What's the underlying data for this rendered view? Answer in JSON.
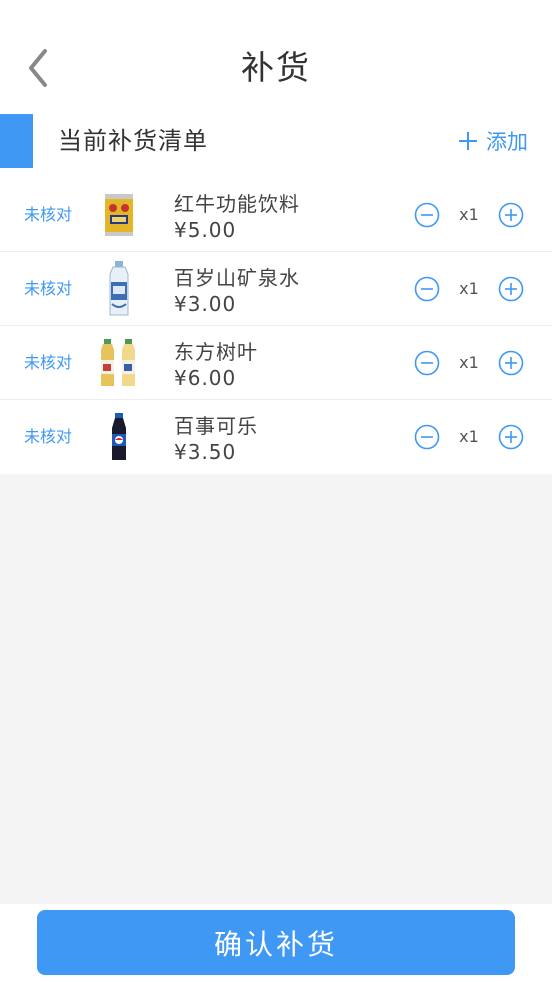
{
  "header": {
    "title": "补货",
    "back_icon": "chevron-left-icon"
  },
  "section": {
    "title": "当前补货清单",
    "add_label": "添加",
    "add_icon": "plus-icon"
  },
  "items": [
    {
      "status": "未核对",
      "name": "红牛功能饮料",
      "price": "¥5.00",
      "qty": "x1",
      "image": "red-bull-can-icon"
    },
    {
      "status": "未核对",
      "name": "百岁山矿泉水",
      "price": "¥3.00",
      "qty": "x1",
      "image": "water-bottle-icon"
    },
    {
      "status": "未核对",
      "name": "东方树叶",
      "price": "¥6.00",
      "qty": "x1",
      "image": "tea-bottles-icon"
    },
    {
      "status": "未核对",
      "name": "百事可乐",
      "price": "¥3.50",
      "qty": "x1",
      "image": "cola-bottle-icon"
    }
  ],
  "footer": {
    "confirm_label": "确认补货"
  },
  "colors": {
    "accent": "#3e98f4",
    "background": "#f4f4f4"
  }
}
